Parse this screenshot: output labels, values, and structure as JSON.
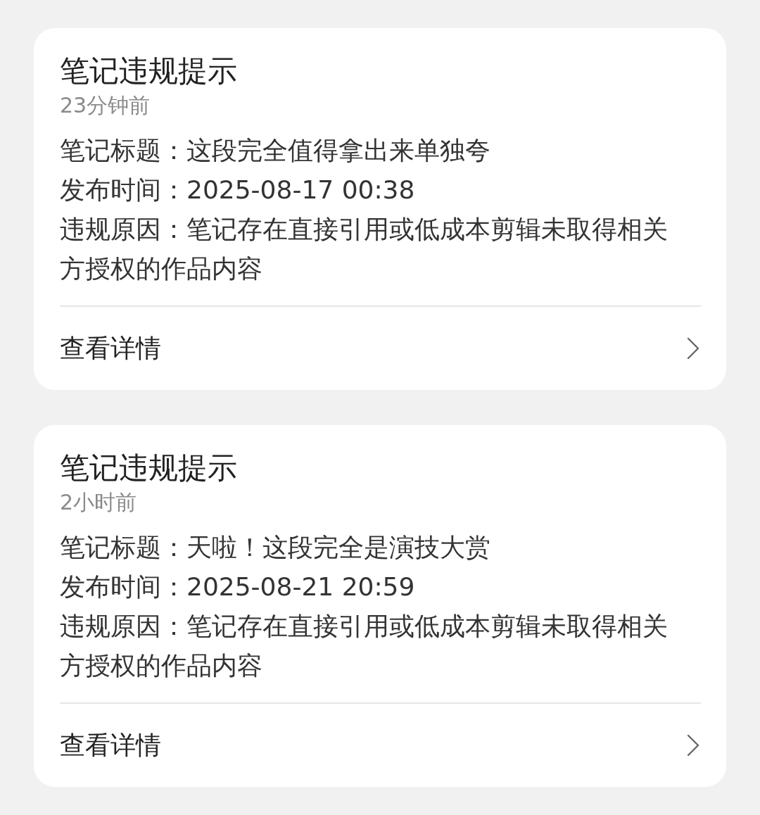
{
  "notices": [
    {
      "title": "笔记违规提示",
      "time": "23分钟前",
      "lines": [
        "笔记标题：这段完全值得拿出来单独夸",
        "发布时间：2025-08-17 00:38",
        "违规原因：笔记存在直接引用或低成本剪辑未取得相关方授权的作品内容"
      ],
      "link": "查看详情"
    },
    {
      "title": "笔记违规提示",
      "time": "2小时前",
      "lines": [
        "笔记标题：天啦！这段完全是演技大赏",
        "发布时间：2025-08-21 20:59",
        "违规原因：笔记存在直接引用或低成本剪辑未取得相关方授权的作品内容"
      ],
      "link": "查看详情"
    }
  ]
}
